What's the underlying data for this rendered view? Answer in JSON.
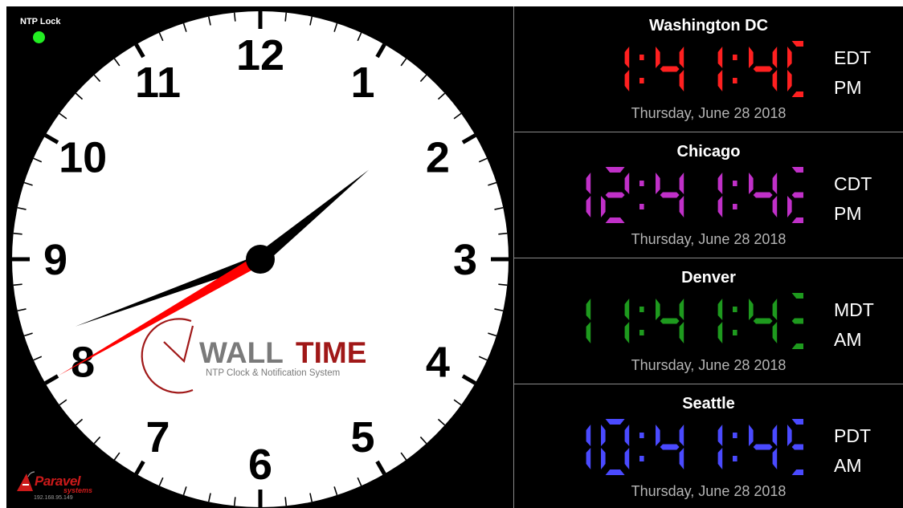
{
  "status": {
    "ntp_label": "NTP Lock",
    "ntp_color": "#22ee22"
  },
  "clock": {
    "numerals": [
      "12",
      "1",
      "2",
      "3",
      "4",
      "5",
      "6",
      "7",
      "8",
      "9",
      "10",
      "11"
    ],
    "hour_hand_time": "1:41",
    "minute": 41,
    "second": 40,
    "logo": {
      "wordmark_left": "WALL",
      "wordmark_right": "TIME",
      "tagline": "NTP Clock & Notification System"
    }
  },
  "branding": {
    "name": "Paravel",
    "sub": "systems",
    "ip": "192.168.95.149"
  },
  "zones": [
    {
      "city": "Washington DC",
      "time": "1:41:40",
      "tz": "EDT",
      "ampm": "PM",
      "date": "Thursday, June 28 2018",
      "color": "#ff2020"
    },
    {
      "city": "Chicago",
      "time": "12:41:42",
      "tz": "CDT",
      "ampm": "PM",
      "date": "Thursday, June 28 2018",
      "color": "#c030c8"
    },
    {
      "city": "Denver",
      "time": "11:41:43",
      "tz": "MDT",
      "ampm": "AM",
      "date": "Thursday, June 28 2018",
      "color": "#1e9a1e"
    },
    {
      "city": "Seattle",
      "time": "10:41:45",
      "tz": "PDT",
      "ampm": "AM",
      "date": "Thursday, June 28 2018",
      "color": "#4a4aff"
    }
  ]
}
